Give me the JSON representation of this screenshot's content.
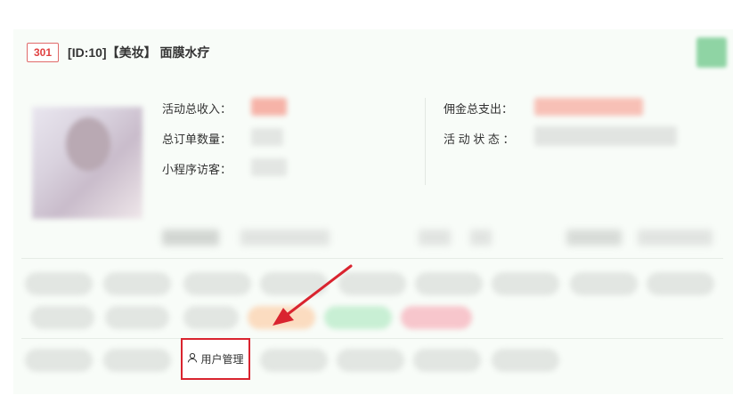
{
  "header": {
    "code_badge": "301",
    "title": "[ID:10]【美妆】 面膜水疗"
  },
  "stats": {
    "activity_total_income_label": "活动总收入：",
    "total_orders_label": "总订单数量：",
    "mini_program_visitors_label": "小程序访客：",
    "commission_total_expense_label": "佣金总支出：",
    "activity_status_label": "活 动 状 态 ："
  },
  "user_management": {
    "label": "用户管理",
    "icon": "user-icon"
  },
  "colors": {
    "badge_border": "#e06a6a",
    "highlight_border": "#d9242f",
    "arrow": "#d9242f",
    "card_background": "#f8fcf8"
  }
}
